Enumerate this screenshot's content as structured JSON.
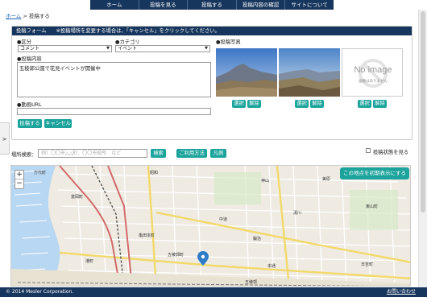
{
  "nav": {
    "items": [
      {
        "label": "ホーム"
      },
      {
        "label": "投稿を見る"
      },
      {
        "label": "投稿する"
      },
      {
        "label": "投稿内容の確認"
      },
      {
        "label": "サイトについて"
      }
    ]
  },
  "breadcrumb": {
    "home": "ホーム",
    "separator": " > ",
    "current": "投稿する"
  },
  "side_tab": {
    "label": ">"
  },
  "form": {
    "title": "投稿フォーム",
    "notice": "※投稿場所を変更する場合は、「キャンセル」をクリックしてください。",
    "category_label": "●区分",
    "category_value": "コメント",
    "subcategory_label": "●カテゴリ",
    "subcategory_value": "イベント",
    "photo_label": "●投稿写真",
    "content_label": "●投稿内容",
    "content_value": "五稜郭公園で花見イベントが開催中",
    "video_label": "●動画URL",
    "video_value": "",
    "submit_label": "投稿する",
    "cancel_label": "キャンセル",
    "photos": [
      {
        "select": "選択",
        "remove": "解除"
      },
      {
        "select": "選択",
        "remove": "解除"
      },
      {
        "select": "選択",
        "remove": "解除"
      }
    ],
    "noimage_big": "No image",
    "noimage_small": "画像はありません"
  },
  "search": {
    "label": "場所検索：",
    "placeholder": "例）〇〇市△△町、〇〇市役所　など",
    "search_btn": "検索",
    "usage_btn": "ご利用方法",
    "legend_btn": "凡例",
    "status_label": "投稿状態を見る"
  },
  "map": {
    "reset_btn": "この地点を初期表示にする",
    "zoom_in": "+",
    "zoom_out": "−",
    "places": [
      "昭和",
      "神山",
      "亀田本町",
      "中道",
      "鍛治",
      "五稜郭町",
      "本通",
      "五稜郭",
      "湯川",
      "東山町",
      "日吉町",
      "港町",
      "万代町",
      "富岡町",
      "美原"
    ]
  },
  "footer": {
    "copyright": "© 2014 Mesler Corporation.",
    "contact": "お問い合わせ"
  },
  "colors": {
    "nav_bg": "#17365d",
    "accent": "#1ba39c",
    "link": "#1a5fb4"
  }
}
